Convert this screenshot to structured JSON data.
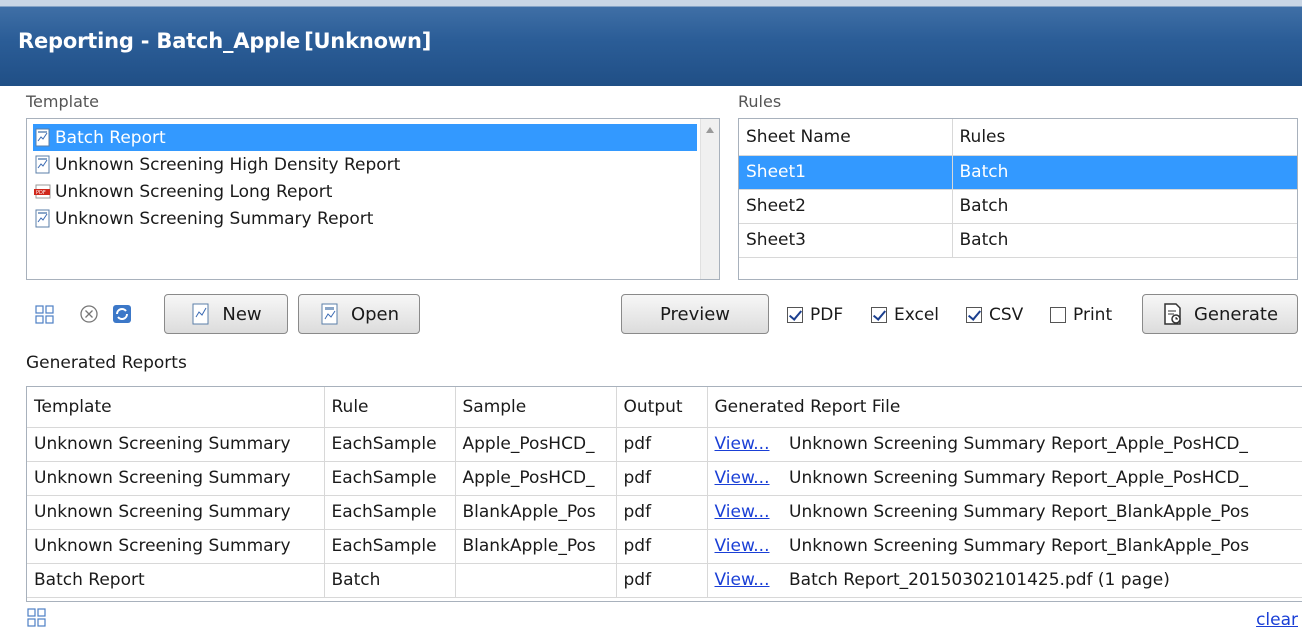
{
  "window": {
    "title": "Reporting - Batch_Apple",
    "subtitle": "[Unknown]"
  },
  "template_panel": {
    "label": "Template",
    "items": [
      {
        "label": "Batch Report",
        "icon": "report-doc-icon",
        "selected": true
      },
      {
        "label": "Unknown Screening High Density Report",
        "icon": "report-doc-icon",
        "selected": false
      },
      {
        "label": "Unknown Screening Long Report",
        "icon": "pdf-icon",
        "selected": false
      },
      {
        "label": "Unknown Screening Summary Report",
        "icon": "report-doc-icon",
        "selected": false
      }
    ]
  },
  "rules_panel": {
    "label": "Rules",
    "headers": [
      "Sheet Name",
      "Rules"
    ],
    "rows": [
      {
        "sheet": "Sheet1",
        "rule": "Batch",
        "selected": true
      },
      {
        "sheet": "Sheet2",
        "rule": "Batch",
        "selected": false
      },
      {
        "sheet": "Sheet3",
        "rule": "Batch",
        "selected": false
      }
    ]
  },
  "toolbar": {
    "new_label": "New",
    "open_label": "Open",
    "preview_label": "Preview",
    "pdf_label": "PDF",
    "excel_label": "Excel",
    "csv_label": "CSV",
    "print_label": "Print",
    "generate_label": "Generate",
    "pdf_checked": true,
    "excel_checked": true,
    "csv_checked": true,
    "print_checked": false
  },
  "generated": {
    "label": "Generated Reports",
    "headers": [
      "Template",
      "Rule",
      "Sample",
      "Output",
      "Generated Report File"
    ],
    "rows": [
      {
        "template": "Unknown Screening Summary",
        "rule": "EachSample",
        "sample": "Apple_PosHCD_",
        "output": "pdf",
        "link": "View...",
        "file": "Unknown Screening Summary Report_Apple_PosHCD_"
      },
      {
        "template": "Unknown Screening Summary",
        "rule": "EachSample",
        "sample": "Apple_PosHCD_",
        "output": "pdf",
        "link": "View...",
        "file": "Unknown Screening Summary Report_Apple_PosHCD_"
      },
      {
        "template": "Unknown Screening Summary",
        "rule": "EachSample",
        "sample": "BlankApple_Pos",
        "output": "pdf",
        "link": "View...",
        "file": "Unknown Screening Summary Report_BlankApple_Pos"
      },
      {
        "template": "Unknown Screening Summary",
        "rule": "EachSample",
        "sample": "BlankApple_Pos",
        "output": "pdf",
        "link": "View...",
        "file": "Unknown Screening Summary Report_BlankApple_Pos"
      },
      {
        "template": "Batch Report",
        "rule": "Batch",
        "sample": "",
        "output": "pdf",
        "link": "View...",
        "file": "Batch Report_20150302101425.pdf (1 page)"
      }
    ],
    "clear_label": "clear"
  },
  "colors": {
    "title_bar": "#2b5d97",
    "selection": "#3399ff",
    "link": "#1a3fd6"
  }
}
